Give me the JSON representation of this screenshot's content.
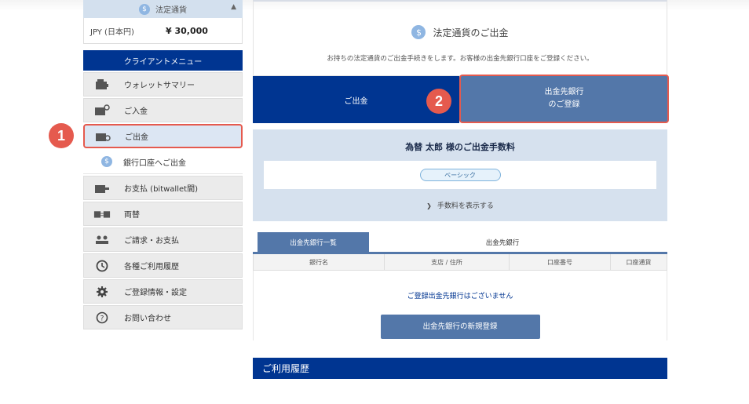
{
  "sidebar": {
    "fiat_header": "法定通貨",
    "balance": {
      "currency": "JPY (日本円)",
      "amount": "¥ 30,000"
    },
    "menu_title": "クライアントメニュー",
    "items": [
      {
        "label": "ウォレットサマリー",
        "icon": "wallet-icon"
      },
      {
        "label": "ご入金",
        "icon": "deposit-icon"
      },
      {
        "label": "ご出金",
        "icon": "withdraw-icon"
      },
      {
        "label": "銀行口座へご出金",
        "icon": "coin-icon"
      },
      {
        "label": "お支払 (bitwallet間)",
        "icon": "payment-icon"
      },
      {
        "label": "両替",
        "icon": "exchange-icon"
      },
      {
        "label": "ご請求・お支払",
        "icon": "users-icon"
      },
      {
        "label": "各種ご利用履歴",
        "icon": "history-icon"
      },
      {
        "label": "ご登録情報・設定",
        "icon": "gear-icon"
      },
      {
        "label": "お問い合わせ",
        "icon": "question-icon"
      }
    ]
  },
  "badges": {
    "step1": "1",
    "step2": "2"
  },
  "main": {
    "title": "法定通貨のご出金",
    "description": "お持ちの法定通貨のご出金手続きをします。お客様の出金先銀行口座をご登録ください。",
    "tab_withdraw": "ご出金",
    "tab_register_line1": "出金先銀行",
    "tab_register_line2": "のご登録",
    "fee_title": "為替 太郎 様のご出金手数料",
    "fee_plan": "ベーシック",
    "fee_show": "手数料を表示する",
    "bank_tabs": [
      "出金先銀行一覧",
      "出金先銀行"
    ],
    "table_headers": [
      "銀行名",
      "支店 / 住所",
      "口座番号",
      "口座通貨"
    ],
    "empty_message": "ご登録出金先銀行はございません",
    "new_button": "出金先銀行の新規登録",
    "history_title": "ご利用履歴"
  },
  "colors": {
    "navy": "#003591",
    "steel": "#5377a9",
    "highlight": "#e55a4e",
    "light_blue": "#d6e1ee"
  }
}
